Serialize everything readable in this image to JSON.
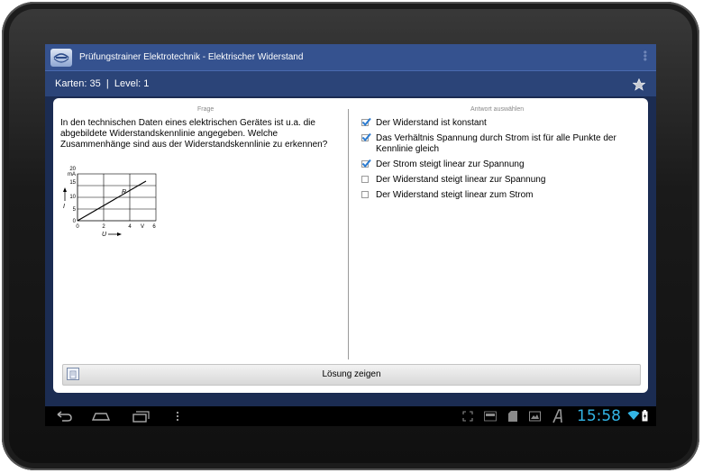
{
  "app": {
    "title": "Prüfungstrainer Elektrotechnik - Elektrischer Widerstand"
  },
  "status": {
    "text": "Karten: 35  |  Level: 1"
  },
  "question": {
    "header": "Frage",
    "text": "In den technischen Daten eines elektrischen Gerätes ist u.a. die abgebildete Widerstandskennlinie angegeben. Welche Zusammenhänge sind aus der Widerstandskennlinie zu erkennen?",
    "graph": {
      "y_unit": "mA",
      "y_ticks": [
        "0",
        "5",
        "10",
        "15",
        "20"
      ],
      "x_ticks": [
        "0",
        "2",
        "4",
        "6"
      ],
      "x_unit": "V",
      "y_label": "I",
      "x_label": "U",
      "curve_label": "R"
    }
  },
  "answers": {
    "header": "Antwort auswählen",
    "items": [
      {
        "label": "Der Widerstand ist konstant",
        "checked": true
      },
      {
        "label": "Das Verhältnis Spannung durch Strom ist für alle Punkte der Kennlinie gleich",
        "checked": true
      },
      {
        "label": "Der Strom steigt linear zur Spannung",
        "checked": true
      },
      {
        "label": "Der Widerstand steigt linear zur Spannung",
        "checked": false
      },
      {
        "label": "Der Widerstand steigt linear zum Strom",
        "checked": false
      }
    ]
  },
  "solution": {
    "label": "Lösung zeigen"
  },
  "system": {
    "clock": "15:58",
    "accent": "#33b5e5"
  },
  "icons": [
    "app-logo-icon",
    "overflow-menu-icon",
    "star-icon",
    "solution-icon",
    "back-icon",
    "home-icon",
    "recent-apps-icon",
    "menu-icon",
    "screenshot-icon",
    "ftp-icon",
    "sd-card-icon",
    "image-icon",
    "font-icon",
    "wifi-icon",
    "battery-icon"
  ]
}
